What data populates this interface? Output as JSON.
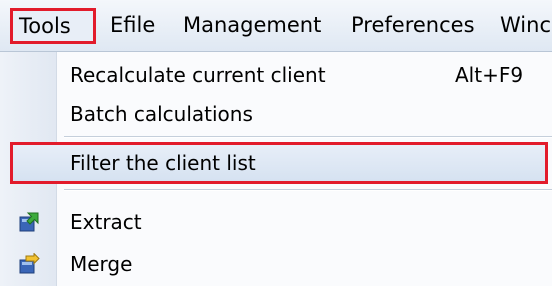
{
  "menubar": {
    "items": [
      {
        "label": "Tools"
      },
      {
        "label": "Efile"
      },
      {
        "label": "Management"
      },
      {
        "label": "Preferences"
      },
      {
        "label": "Winc"
      }
    ]
  },
  "tools_menu": {
    "items": [
      {
        "label": "Recalculate current client",
        "shortcut": "Alt+F9"
      },
      {
        "label": "Batch calculations"
      },
      {
        "label": "Filter the client list"
      },
      {
        "label": "Extract",
        "icon": "extract-icon"
      },
      {
        "label": "Merge",
        "icon": "merge-icon"
      }
    ]
  },
  "colors": {
    "highlight_border": "#e21b2b",
    "menu_background": "#fafbfd",
    "gutter": "#e1e8f2"
  }
}
